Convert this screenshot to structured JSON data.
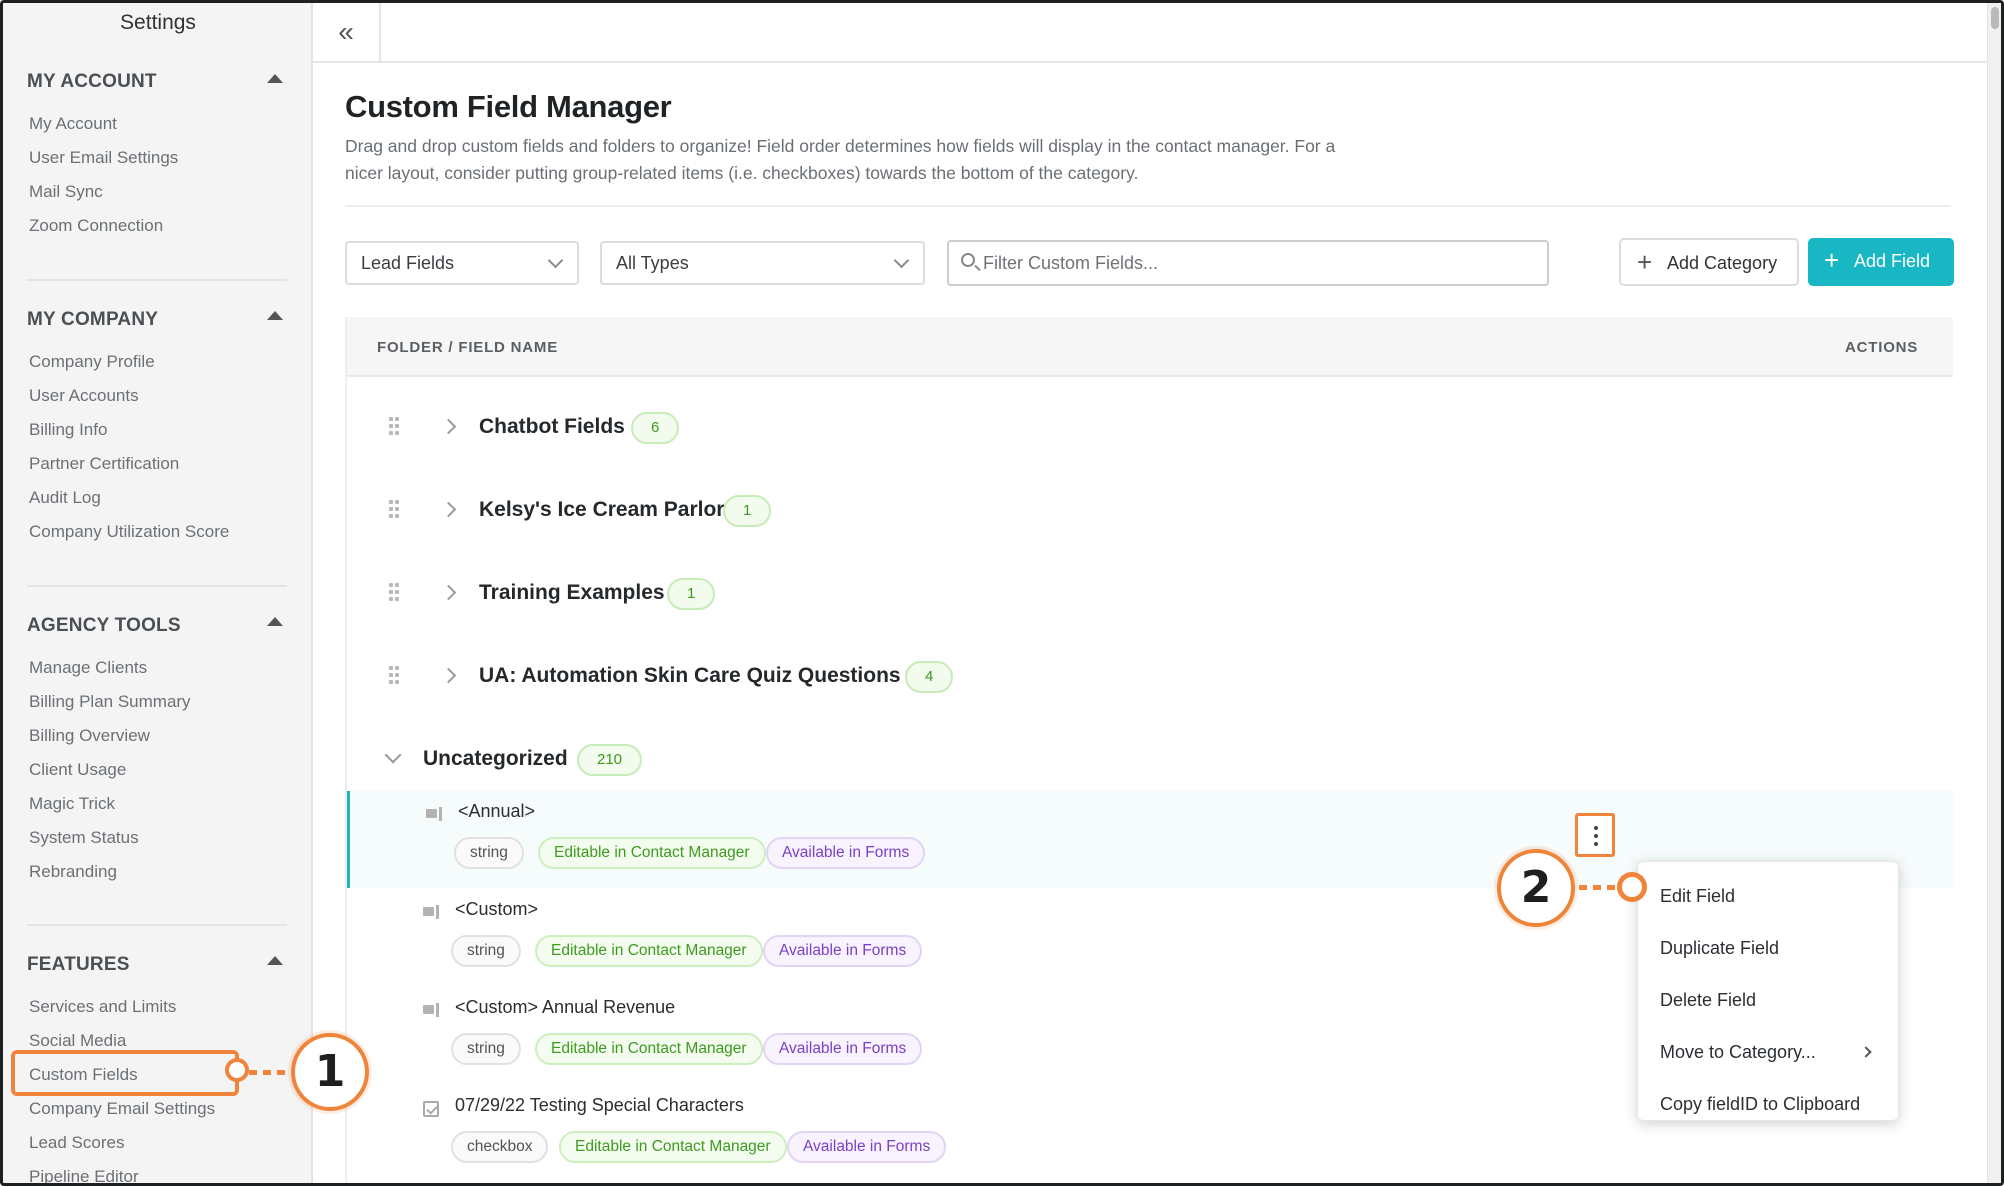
{
  "sidebar": {
    "title": "Settings",
    "sections": [
      {
        "heading": "MY ACCOUNT",
        "items": [
          "My Account",
          "User Email Settings",
          "Mail Sync",
          "Zoom Connection"
        ]
      },
      {
        "heading": "MY COMPANY",
        "items": [
          "Company Profile",
          "User Accounts",
          "Billing Info",
          "Partner Certification",
          "Audit Log",
          "Company Utilization Score"
        ]
      },
      {
        "heading": "AGENCY TOOLS",
        "items": [
          "Manage Clients",
          "Billing Plan Summary",
          "Billing Overview",
          "Client Usage",
          "Magic Trick",
          "System Status",
          "Rebranding"
        ]
      },
      {
        "heading": "FEATURES",
        "items": [
          "Services and Limits",
          "Social Media",
          "Custom Fields",
          "Company Email Settings",
          "Lead Scores",
          "Pipeline Editor"
        ]
      }
    ]
  },
  "topbar": {
    "collapse_icon": "double-chevron-left-icon",
    "collapse_glyph": "«"
  },
  "page": {
    "title": "Custom Field Manager",
    "description": "Drag and drop custom fields and folders to organize! Field order determines how fields will display in the contact manager. For a nicer layout, consider putting group-related items (i.e. checkboxes) towards the bottom of the category."
  },
  "filters": {
    "field_group": "Lead Fields",
    "type": "All Types",
    "search_placeholder": "Filter Custom Fields...",
    "add_category_label": "Add Category",
    "add_field_label": "Add Field"
  },
  "table": {
    "col_name": "FOLDER / FIELD NAME",
    "col_actions": "ACTIONS",
    "folders": [
      {
        "name": "Chatbot Fields",
        "count": "6"
      },
      {
        "name": "Kelsy's Ice Cream Parlor",
        "count": "1"
      },
      {
        "name": "Training Examples",
        "count": "1"
      },
      {
        "name": "UA: Automation Skin Care Quiz Questions",
        "count": "4"
      }
    ],
    "uncategorized": {
      "name": "Uncategorized",
      "count": "210"
    },
    "fields": [
      {
        "name": "<Annual>",
        "type": "string",
        "tag_edit": "Editable in Contact Manager",
        "tag_form": "Available in Forms",
        "icon": "text-field-icon"
      },
      {
        "name": "<Custom>",
        "type": "string",
        "tag_edit": "Editable in Contact Manager",
        "tag_form": "Available in Forms",
        "icon": "text-field-icon"
      },
      {
        "name": "<Custom> Annual Revenue",
        "type": "string",
        "tag_edit": "Editable in Contact Manager",
        "tag_form": "Available in Forms",
        "icon": "text-field-icon"
      },
      {
        "name": "07/29/22 Testing Special Characters",
        "type": "checkbox",
        "tag_edit": "Editable in Contact Manager",
        "tag_form": "Available in Forms",
        "icon": "checkbox-icon"
      }
    ]
  },
  "context_menu": {
    "items": [
      "Edit Field",
      "Duplicate Field",
      "Delete Field",
      "Move to Category...",
      "Copy fieldID to Clipboard"
    ]
  },
  "callouts": {
    "step1": "1",
    "step2": "2"
  },
  "colors": {
    "accent": "#19b7c4",
    "callout": "#f0843a",
    "tag_green": "#3d9b1f",
    "tag_purple": "#7b3fc4"
  }
}
